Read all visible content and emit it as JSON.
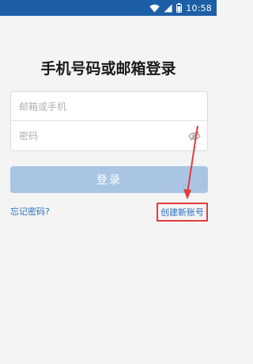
{
  "status_bar": {
    "time": "10:58",
    "icons": [
      "wifi-icon",
      "signal-icon",
      "battery-icon"
    ]
  },
  "login": {
    "title": "手机号码或邮箱登录",
    "account_placeholder": "邮箱或手机",
    "account_value": "",
    "password_placeholder": "密码",
    "password_value": "",
    "password_toggle_icon": "eye-off-icon",
    "submit_label": "登录",
    "forgot_password_label": "忘记密码?",
    "create_account_label": "创建新账号"
  },
  "annotation": {
    "highlight_color": "#e23b3b",
    "target": "创建新账号"
  },
  "colors": {
    "status_bar": "#1c5fa6",
    "background": "#f4f4f4",
    "button_disabled": "#a9c5e3",
    "link": "#2a6fbf"
  }
}
